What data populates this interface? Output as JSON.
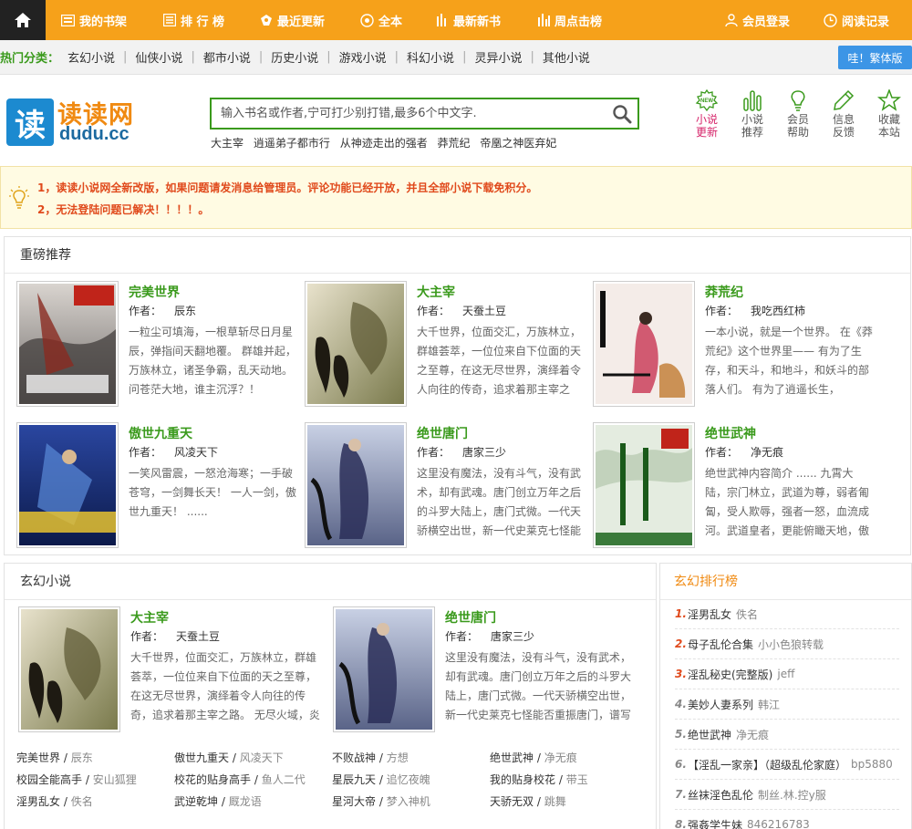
{
  "nav": {
    "items": [
      {
        "label": "我的书架"
      },
      {
        "label": "排 行 榜"
      },
      {
        "label": "最近更新"
      },
      {
        "label": "全本"
      },
      {
        "label": "最新新书"
      },
      {
        "label": "周点击榜"
      }
    ],
    "login": "会员登录",
    "history": "阅读记录"
  },
  "hot_categories": {
    "label": "热门分类：",
    "items": [
      "玄幻小说",
      "仙侠小说",
      "都市小说",
      "历史小说",
      "游戏小说",
      "科幻小说",
      "灵异小说",
      "其他小说"
    ]
  },
  "traditional_button": "哇！繁体版",
  "logo": {
    "icon_char": "读",
    "title": "读读网",
    "subtitle": "dudu.cc"
  },
  "search": {
    "placeholder": "输入书名或作者,宁可打少别打错,最多6个中文字."
  },
  "hot_searches": [
    "大主宰",
    "逍遥弟子都市行",
    "从神迹走出的强者",
    "莽荒纪",
    "帝凰之神医弃妃"
  ],
  "quick_links": [
    {
      "label1": "小说",
      "label2": "更新",
      "icon": "new-icon"
    },
    {
      "label1": "小说",
      "label2": "推荐",
      "icon": "bar-chart-icon"
    },
    {
      "label1": "会员",
      "label2": "帮助",
      "icon": "lightbulb-icon"
    },
    {
      "label1": "信息",
      "label2": "反馈",
      "icon": "pencil-icon"
    },
    {
      "label1": "收藏",
      "label2": "本站",
      "icon": "star-icon"
    }
  ],
  "notice": {
    "lines": [
      "1，读读小说网全新改版，如果问题请发消息给管理员。评论功能已经开放，并且全部小说下载免积分。",
      "2，无法登陆问题已解决！！！！。"
    ]
  },
  "author_label": "作者：",
  "featured": {
    "title": "重磅推荐",
    "books": [
      {
        "title": "完美世界",
        "author": "辰东",
        "desc": "一粒尘可填海，一根草斩尽日月星辰，弹指间天翻地覆。 群雄并起，万族林立，诸圣争霸，乱天动地。问苍茫大地，谁主沉浮？！"
      },
      {
        "title": "大主宰",
        "author": "天蚕土豆",
        "desc": "大千世界，位面交汇，万族林立，群雄荟萃，一位位来自下位面的天之至尊，在这无尽世界，演绎着令人向往的传奇，追求着那主宰之"
      },
      {
        "title": "莽荒纪",
        "author": "我吃西红柿",
        "desc": "一本小说，就是一个世界。 在《莽荒纪》这个世界里—— 有为了生存，和天斗，和地斗，和妖斗的部落人们。 有为了逍遥长生，"
      },
      {
        "title": "傲世九重天",
        "author": "风凌天下",
        "desc": "一笑风雷震，一怒沧海寒；一手破苍穹，一剑舞长天！ 一人一剑，傲世九重天！ ......"
      },
      {
        "title": "绝世唐门",
        "author": "唐家三少",
        "desc": "这里没有魔法，没有斗气，没有武术，却有武魂。唐门创立万年之后的斗罗大陆上，唐门式微。一代天骄横空出世，新一代史莱克七怪能"
      },
      {
        "title": "绝世武神",
        "author": "净无痕",
        "desc": "绝世武神内容简介 ...... 九霄大陆，宗门林立，武道为尊，弱者匍匐，受人欺辱，强者一怒，血流成河。武道皇者，更能俯瞰天地，傲笑河"
      }
    ]
  },
  "xuanhuan": {
    "title": "玄幻小说",
    "books": [
      {
        "title": "大主宰",
        "author": "天蚕土豆",
        "desc": "大千世界，位面交汇，万族林立，群雄荟萃，一位位来自下位面的天之至尊，在这无尽世界，演绎着令人向往的传奇，追求着那主宰之路。 无尽火域，炎"
      },
      {
        "title": "绝世唐门",
        "author": "唐家三少",
        "desc": "这里没有魔法，没有斗气，没有武术，却有武魂。唐门创立万年之后的斗罗大陆上，唐门式微。一代天骄横空出世，新一代史莱克七怪能否重振唐门，谱写"
      }
    ],
    "list": [
      [
        {
          "t": "完美世界",
          "a": "辰东"
        },
        {
          "t": "傲世九重天",
          "a": "风凌天下"
        },
        {
          "t": "不败战神",
          "a": "方想"
        },
        {
          "t": "绝世武神",
          "a": "净无痕"
        }
      ],
      [
        {
          "t": "校园全能高手",
          "a": "安山狐狸"
        },
        {
          "t": "校花的贴身高手",
          "a": "鱼人二代"
        },
        {
          "t": "星辰九天",
          "a": "追忆夜魄"
        },
        {
          "t": "我的贴身校花",
          "a": "带玉"
        }
      ],
      [
        {
          "t": "淫男乱女",
          "a": "佚名"
        },
        {
          "t": "武逆乾坤",
          "a": "厩龙语"
        },
        {
          "t": "星河大帝",
          "a": "梦入神机"
        },
        {
          "t": "天骄无双",
          "a": "跳舞"
        }
      ]
    ]
  },
  "ranking": {
    "title": "玄幻排行榜",
    "items": [
      {
        "n": "1.",
        "t": "淫男乱女",
        "a": "佚名"
      },
      {
        "n": "2.",
        "t": "母子乱伦合集",
        "a": "小小色狼转载"
      },
      {
        "n": "3.",
        "t": "淫乱秘史(完整版)",
        "a": "jeff"
      },
      {
        "n": "4.",
        "t": "美妙人妻系列",
        "a": "韩江"
      },
      {
        "n": "5.",
        "t": "绝世武神",
        "a": "净无痕"
      },
      {
        "n": "6.",
        "t": "【淫乱一家亲】（超级乱伦家庭）",
        "a": "bp5880"
      },
      {
        "n": "7.",
        "t": "丝袜淫色乱伦",
        "a": "制丝.林.控y服"
      },
      {
        "n": "8.",
        "t": "强姦学生妹",
        "a": "846216783"
      }
    ]
  },
  "colors": {
    "nav_bg": "#f6a11a",
    "accent_green": "#3a9a1c",
    "notice_red": "#e04a1c",
    "rank_orange": "#f08a12",
    "trad_blue": "#3c95e6"
  }
}
